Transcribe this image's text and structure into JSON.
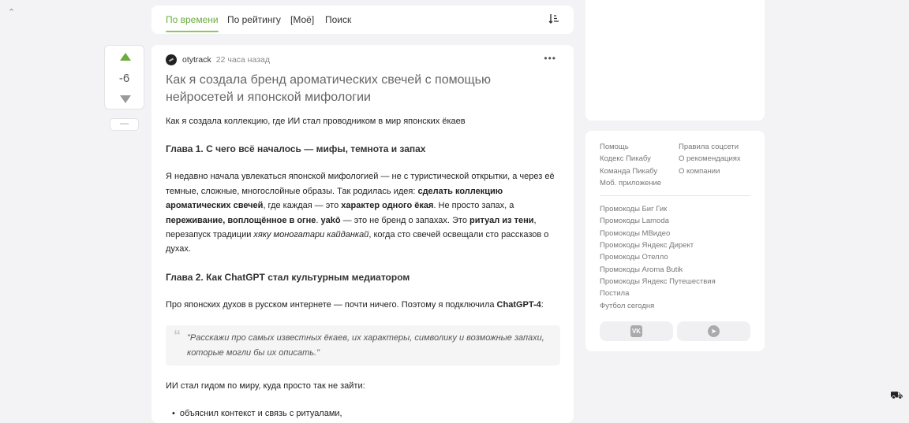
{
  "tabs": [
    {
      "label": "По времени",
      "active": true
    },
    {
      "label": "По рейтингу"
    },
    {
      "label": "[Моё]"
    },
    {
      "label": "Поиск"
    }
  ],
  "vote": {
    "score": "-6",
    "minus": "—"
  },
  "post": {
    "author": "otytrack",
    "time": "22 часа назад",
    "title": "Как я создала бренд ароматических свечей с помощью нейросетей и японской мифологии",
    "intro": "Как я создала коллекцию, где ИИ стал проводником в мир японских ёкаев",
    "h1": "Глава 1. С чего всё началось — мифы, темнота и запах",
    "p1": [
      {
        "t": "Я недавно начала увлекаться японской мифологией — не с туристической открытки, а через её темные, сложные, многослойные образы. Так родилась идея: "
      },
      {
        "t": "сделать коллекцию ароматических свечей",
        "b": true
      },
      {
        "t": ", где каждая — это "
      },
      {
        "t": "характер одного ёкая",
        "b": true
      },
      {
        "t": ". Не просто запах, а "
      },
      {
        "t": "переживание, воплощённое в огне",
        "b": true
      },
      {
        "t": ". "
      },
      {
        "t": "yakō",
        "b": true
      },
      {
        "t": " — это не бренд о запахах. Это "
      },
      {
        "t": "ритуал из тени",
        "b": true
      },
      {
        "t": ", перезапуск традиции "
      },
      {
        "t": "хяку моногатари кайданкай",
        "i": true
      },
      {
        "t": ", когда сто свечей освещали сто рассказов о духах."
      }
    ],
    "h2": "Глава 2. Как ChatGPT стал культурным медиатором",
    "p2": [
      {
        "t": "Про японских духов в русском интернете — почти ничего. Поэтому я подключила "
      },
      {
        "t": "ChatGPT-4",
        "b": true
      },
      {
        "t": ":"
      }
    ],
    "quote": "\"Расскажи про самых известных ёкаев, их характеры, символику и возможные запахи, которые могли бы их описать.\"",
    "p3": "ИИ стал гидом по миру, куда просто так не зайти:",
    "list": [
      "объяснил контекст и связь с ритуалами,"
    ]
  },
  "sidebar": {
    "col1": [
      "Помощь",
      "Кодекс Пикабу",
      "Команда Пикабу",
      "Моб. приложение"
    ],
    "col2": [
      "Правила соцсети",
      "О рекомендациях",
      "О компании"
    ],
    "promo": [
      "Промокоды Биг Гик",
      "Промокоды Lamoda",
      "Промокоды МВидео",
      "Промокоды Яндекс Директ",
      "Промокоды Отелло",
      "Промокоды Aroma Butik",
      "Промокоды Яндекс Путешествия",
      "Постила",
      "Футбол сегодня"
    ],
    "vk": "VK"
  }
}
